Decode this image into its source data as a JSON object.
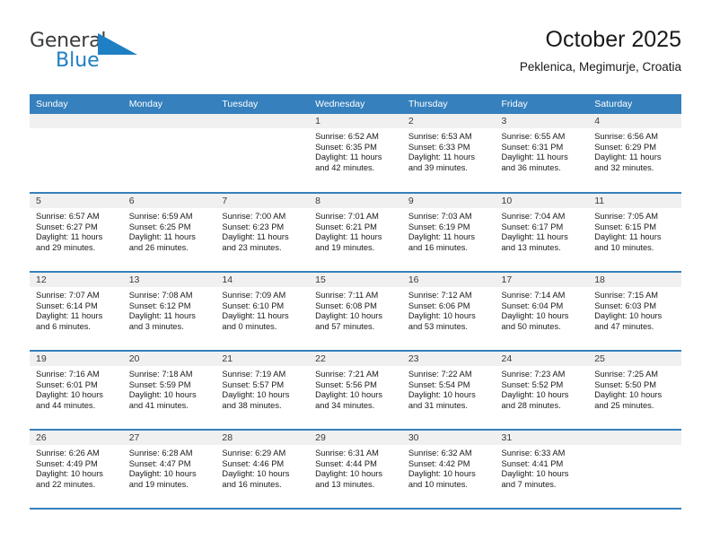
{
  "brand": {
    "name_top": "General",
    "name_bottom": "Blue",
    "triangle_color": "#1f7fc4",
    "logo_icon": "triangle-logo-icon"
  },
  "header": {
    "title": "October 2025",
    "subtitle": "Peklenica, Megimurje, Croatia"
  },
  "theme": {
    "header_blue": "#3580bd",
    "band_gray": "#f0f0f0",
    "text": "#1a1a1a"
  },
  "calendar": {
    "weekday_headers": [
      "Sunday",
      "Monday",
      "Tuesday",
      "Wednesday",
      "Thursday",
      "Friday",
      "Saturday"
    ],
    "labels": {
      "sunrise": "Sunrise:",
      "sunset": "Sunset:",
      "daylight": "Daylight:"
    },
    "weeks": [
      [
        {
          "day": "",
          "empty": true,
          "sunrise": "",
          "sunset": "",
          "daylight_line1": "",
          "daylight_line2": ""
        },
        {
          "day": "",
          "empty": true,
          "sunrise": "",
          "sunset": "",
          "daylight_line1": "",
          "daylight_line2": ""
        },
        {
          "day": "",
          "empty": true,
          "sunrise": "",
          "sunset": "",
          "daylight_line1": "",
          "daylight_line2": ""
        },
        {
          "day": "1",
          "sunrise": "Sunrise: 6:52 AM",
          "sunset": "Sunset: 6:35 PM",
          "daylight_line1": "Daylight: 11 hours",
          "daylight_line2": "and 42 minutes."
        },
        {
          "day": "2",
          "sunrise": "Sunrise: 6:53 AM",
          "sunset": "Sunset: 6:33 PM",
          "daylight_line1": "Daylight: 11 hours",
          "daylight_line2": "and 39 minutes."
        },
        {
          "day": "3",
          "sunrise": "Sunrise: 6:55 AM",
          "sunset": "Sunset: 6:31 PM",
          "daylight_line1": "Daylight: 11 hours",
          "daylight_line2": "and 36 minutes."
        },
        {
          "day": "4",
          "sunrise": "Sunrise: 6:56 AM",
          "sunset": "Sunset: 6:29 PM",
          "daylight_line1": "Daylight: 11 hours",
          "daylight_line2": "and 32 minutes."
        }
      ],
      [
        {
          "day": "5",
          "sunrise": "Sunrise: 6:57 AM",
          "sunset": "Sunset: 6:27 PM",
          "daylight_line1": "Daylight: 11 hours",
          "daylight_line2": "and 29 minutes."
        },
        {
          "day": "6",
          "sunrise": "Sunrise: 6:59 AM",
          "sunset": "Sunset: 6:25 PM",
          "daylight_line1": "Daylight: 11 hours",
          "daylight_line2": "and 26 minutes."
        },
        {
          "day": "7",
          "sunrise": "Sunrise: 7:00 AM",
          "sunset": "Sunset: 6:23 PM",
          "daylight_line1": "Daylight: 11 hours",
          "daylight_line2": "and 23 minutes."
        },
        {
          "day": "8",
          "sunrise": "Sunrise: 7:01 AM",
          "sunset": "Sunset: 6:21 PM",
          "daylight_line1": "Daylight: 11 hours",
          "daylight_line2": "and 19 minutes."
        },
        {
          "day": "9",
          "sunrise": "Sunrise: 7:03 AM",
          "sunset": "Sunset: 6:19 PM",
          "daylight_line1": "Daylight: 11 hours",
          "daylight_line2": "and 16 minutes."
        },
        {
          "day": "10",
          "sunrise": "Sunrise: 7:04 AM",
          "sunset": "Sunset: 6:17 PM",
          "daylight_line1": "Daylight: 11 hours",
          "daylight_line2": "and 13 minutes."
        },
        {
          "day": "11",
          "sunrise": "Sunrise: 7:05 AM",
          "sunset": "Sunset: 6:15 PM",
          "daylight_line1": "Daylight: 11 hours",
          "daylight_line2": "and 10 minutes."
        }
      ],
      [
        {
          "day": "12",
          "sunrise": "Sunrise: 7:07 AM",
          "sunset": "Sunset: 6:14 PM",
          "daylight_line1": "Daylight: 11 hours",
          "daylight_line2": "and 6 minutes."
        },
        {
          "day": "13",
          "sunrise": "Sunrise: 7:08 AM",
          "sunset": "Sunset: 6:12 PM",
          "daylight_line1": "Daylight: 11 hours",
          "daylight_line2": "and 3 minutes."
        },
        {
          "day": "14",
          "sunrise": "Sunrise: 7:09 AM",
          "sunset": "Sunset: 6:10 PM",
          "daylight_line1": "Daylight: 11 hours",
          "daylight_line2": "and 0 minutes."
        },
        {
          "day": "15",
          "sunrise": "Sunrise: 7:11 AM",
          "sunset": "Sunset: 6:08 PM",
          "daylight_line1": "Daylight: 10 hours",
          "daylight_line2": "and 57 minutes."
        },
        {
          "day": "16",
          "sunrise": "Sunrise: 7:12 AM",
          "sunset": "Sunset: 6:06 PM",
          "daylight_line1": "Daylight: 10 hours",
          "daylight_line2": "and 53 minutes."
        },
        {
          "day": "17",
          "sunrise": "Sunrise: 7:14 AM",
          "sunset": "Sunset: 6:04 PM",
          "daylight_line1": "Daylight: 10 hours",
          "daylight_line2": "and 50 minutes."
        },
        {
          "day": "18",
          "sunrise": "Sunrise: 7:15 AM",
          "sunset": "Sunset: 6:03 PM",
          "daylight_line1": "Daylight: 10 hours",
          "daylight_line2": "and 47 minutes."
        }
      ],
      [
        {
          "day": "19",
          "sunrise": "Sunrise: 7:16 AM",
          "sunset": "Sunset: 6:01 PM",
          "daylight_line1": "Daylight: 10 hours",
          "daylight_line2": "and 44 minutes."
        },
        {
          "day": "20",
          "sunrise": "Sunrise: 7:18 AM",
          "sunset": "Sunset: 5:59 PM",
          "daylight_line1": "Daylight: 10 hours",
          "daylight_line2": "and 41 minutes."
        },
        {
          "day": "21",
          "sunrise": "Sunrise: 7:19 AM",
          "sunset": "Sunset: 5:57 PM",
          "daylight_line1": "Daylight: 10 hours",
          "daylight_line2": "and 38 minutes."
        },
        {
          "day": "22",
          "sunrise": "Sunrise: 7:21 AM",
          "sunset": "Sunset: 5:56 PM",
          "daylight_line1": "Daylight: 10 hours",
          "daylight_line2": "and 34 minutes."
        },
        {
          "day": "23",
          "sunrise": "Sunrise: 7:22 AM",
          "sunset": "Sunset: 5:54 PM",
          "daylight_line1": "Daylight: 10 hours",
          "daylight_line2": "and 31 minutes."
        },
        {
          "day": "24",
          "sunrise": "Sunrise: 7:23 AM",
          "sunset": "Sunset: 5:52 PM",
          "daylight_line1": "Daylight: 10 hours",
          "daylight_line2": "and 28 minutes."
        },
        {
          "day": "25",
          "sunrise": "Sunrise: 7:25 AM",
          "sunset": "Sunset: 5:50 PM",
          "daylight_line1": "Daylight: 10 hours",
          "daylight_line2": "and 25 minutes."
        }
      ],
      [
        {
          "day": "26",
          "sunrise": "Sunrise: 6:26 AM",
          "sunset": "Sunset: 4:49 PM",
          "daylight_line1": "Daylight: 10 hours",
          "daylight_line2": "and 22 minutes."
        },
        {
          "day": "27",
          "sunrise": "Sunrise: 6:28 AM",
          "sunset": "Sunset: 4:47 PM",
          "daylight_line1": "Daylight: 10 hours",
          "daylight_line2": "and 19 minutes."
        },
        {
          "day": "28",
          "sunrise": "Sunrise: 6:29 AM",
          "sunset": "Sunset: 4:46 PM",
          "daylight_line1": "Daylight: 10 hours",
          "daylight_line2": "and 16 minutes."
        },
        {
          "day": "29",
          "sunrise": "Sunrise: 6:31 AM",
          "sunset": "Sunset: 4:44 PM",
          "daylight_line1": "Daylight: 10 hours",
          "daylight_line2": "and 13 minutes."
        },
        {
          "day": "30",
          "sunrise": "Sunrise: 6:32 AM",
          "sunset": "Sunset: 4:42 PM",
          "daylight_line1": "Daylight: 10 hours",
          "daylight_line2": "and 10 minutes."
        },
        {
          "day": "31",
          "sunrise": "Sunrise: 6:33 AM",
          "sunset": "Sunset: 4:41 PM",
          "daylight_line1": "Daylight: 10 hours",
          "daylight_line2": "and 7 minutes."
        },
        {
          "day": "",
          "empty": true,
          "sunrise": "",
          "sunset": "",
          "daylight_line1": "",
          "daylight_line2": ""
        }
      ]
    ]
  }
}
